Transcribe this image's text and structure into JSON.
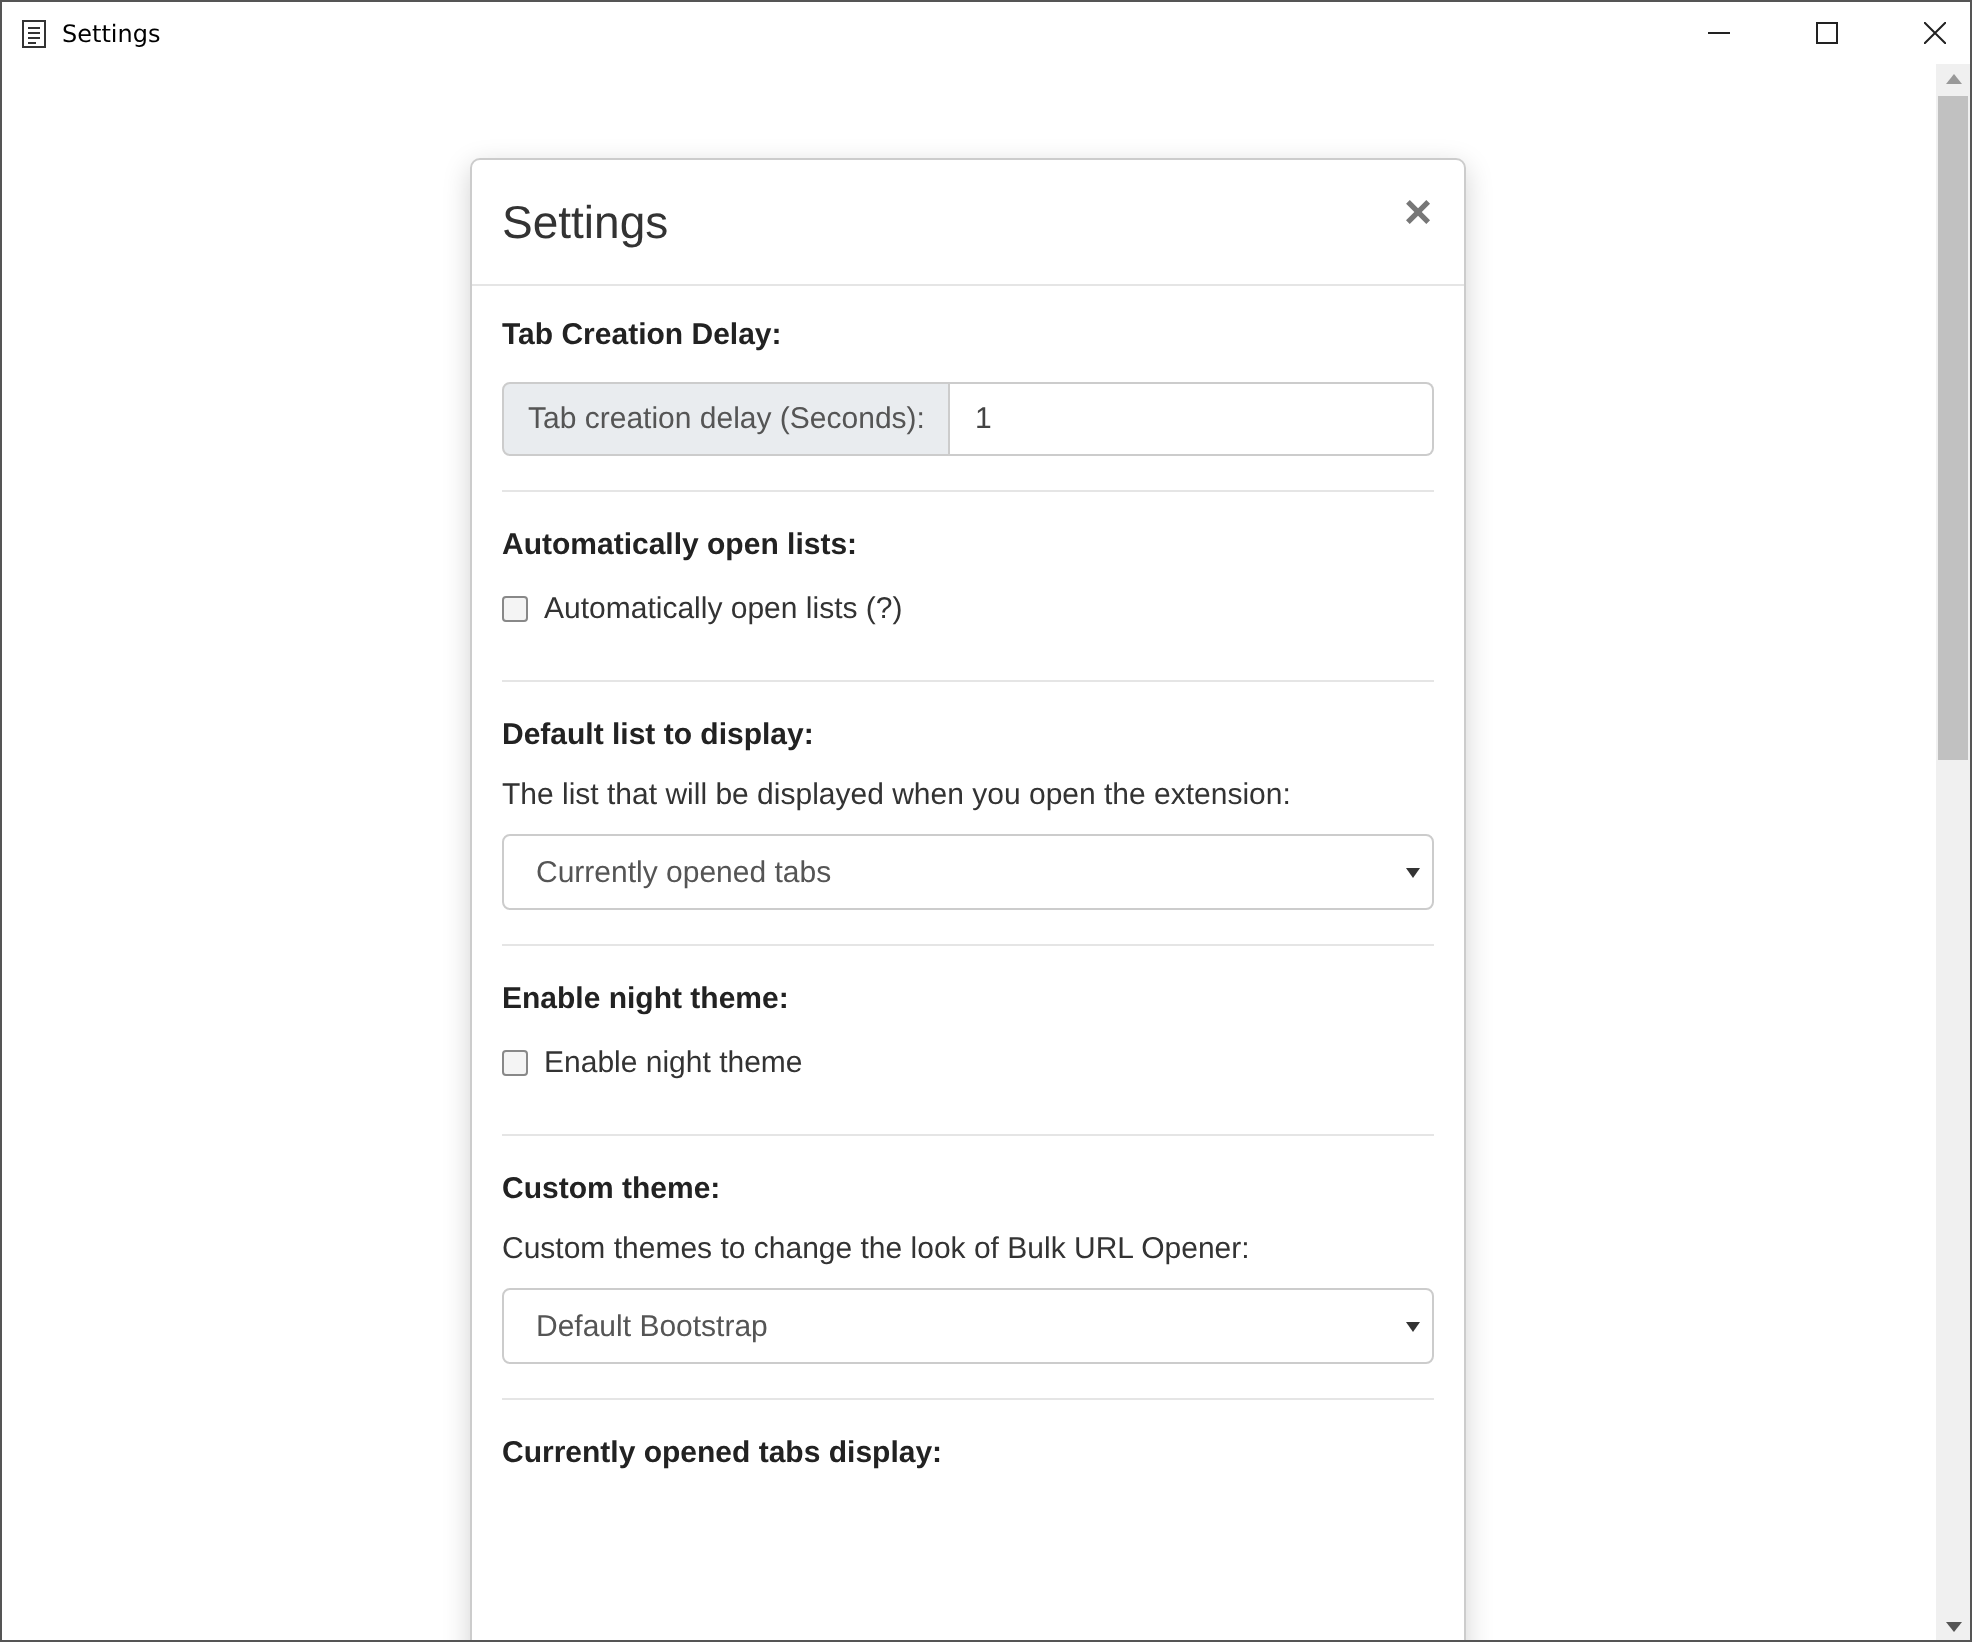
{
  "window": {
    "title": "Settings"
  },
  "modal": {
    "title": "Settings",
    "close": "×"
  },
  "sections": [
    {
      "kind": "input_group",
      "heading": "Tab Creation Delay:",
      "addon": "Tab creation delay (Seconds):",
      "value": "1"
    },
    {
      "kind": "checkbox",
      "heading": "Automatically open lists:",
      "label": "Automatically open lists (?)",
      "checked": false
    },
    {
      "kind": "select",
      "heading": "Default list to display:",
      "description": "The list that will be displayed when you open the extension:",
      "value": "Currently opened tabs"
    },
    {
      "kind": "checkbox",
      "heading": "Enable night theme:",
      "label": "Enable night theme",
      "checked": false
    },
    {
      "kind": "select",
      "heading": "Custom theme:",
      "description": "Custom themes to change the look of Bulk URL Opener:",
      "value": "Default Bootstrap"
    },
    {
      "kind": "heading_only",
      "heading": "Currently opened tabs display:"
    }
  ]
}
